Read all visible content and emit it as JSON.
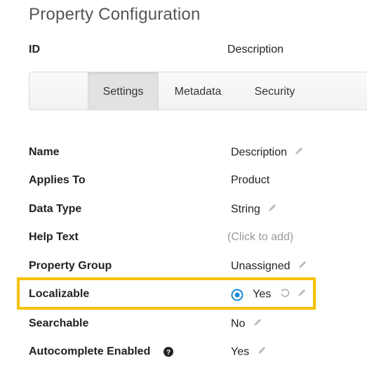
{
  "page": {
    "title": "Property Configuration"
  },
  "header": {
    "id_label": "ID",
    "id_value": "Description"
  },
  "tabs": [
    {
      "label": "Settings",
      "active": true
    },
    {
      "label": "Metadata",
      "active": false
    },
    {
      "label": "Security",
      "active": false
    }
  ],
  "properties": [
    {
      "label": "Name",
      "value": "Description",
      "editable": true
    },
    {
      "label": "Applies To",
      "value": "Product",
      "editable": false
    },
    {
      "label": "Data Type",
      "value": "String",
      "editable": true
    },
    {
      "label": "Help Text",
      "value": "(Click to add)",
      "placeholder": true
    },
    {
      "label": "Property Group",
      "value": "Unassigned",
      "editable": true
    },
    {
      "label": "Localizable",
      "value": "Yes",
      "radio_selected": true,
      "undo": true,
      "editable": true,
      "highlighted": true
    },
    {
      "label": "Searchable",
      "value": "No",
      "editable": true
    },
    {
      "label": "Autocomplete Enabled",
      "value": "Yes",
      "editable": true,
      "help": true
    }
  ],
  "colors": {
    "highlight": "#f5c200",
    "radio": "#1a8ad6",
    "icon_gray": "#b0b0b0",
    "placeholder": "#9a9a9a"
  },
  "icons": {
    "edit": "pencil-icon",
    "undo": "undo-icon",
    "help": "question-circle-icon",
    "radio": "radio-selected-icon"
  }
}
